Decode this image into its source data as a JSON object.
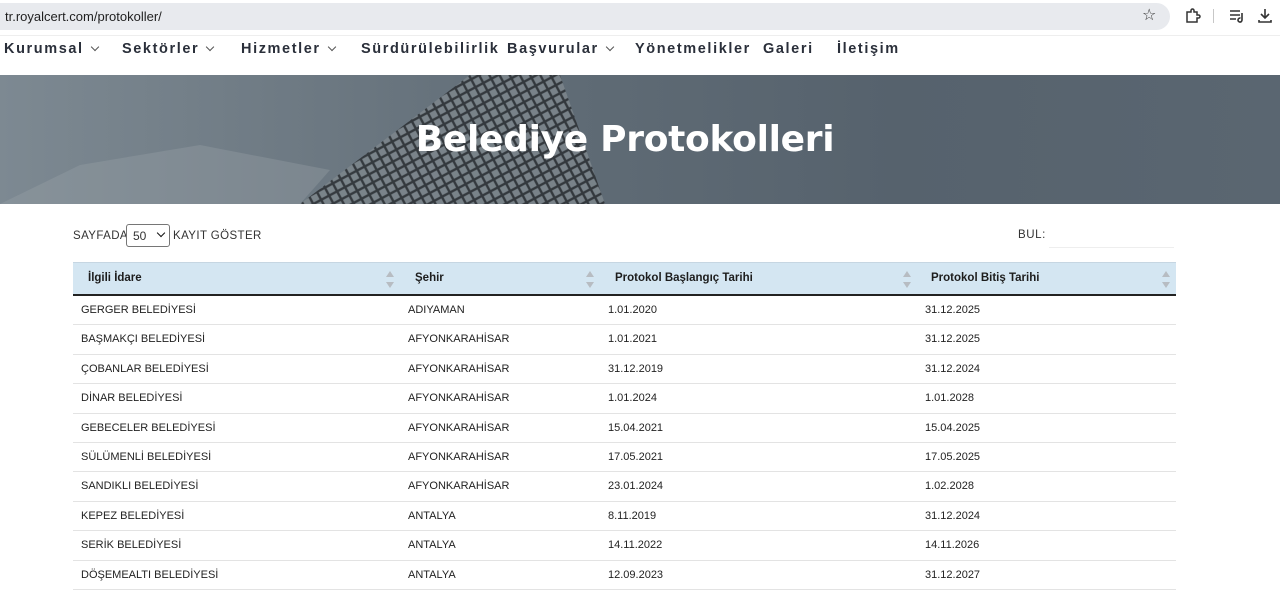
{
  "browser": {
    "url": "tr.royalcert.com/protokoller/"
  },
  "nav": {
    "items": [
      {
        "label": "Kurumsal",
        "has_menu": true
      },
      {
        "label": "Sektörler",
        "has_menu": true
      },
      {
        "label": "Hizmetler",
        "has_menu": true
      },
      {
        "label": "Sürdürülebilirlik",
        "has_menu": false
      },
      {
        "label": "Başvurular",
        "has_menu": true
      },
      {
        "label": "Yönetmelikler",
        "has_menu": false
      },
      {
        "label": "Galeri",
        "has_menu": false
      },
      {
        "label": "İletişim",
        "has_menu": false
      }
    ]
  },
  "hero": {
    "title": "Belediye Protokolleri"
  },
  "controls": {
    "length_prefix": "SAYFADA",
    "length_value": "50",
    "length_suffix": "KAYIT GÖSTER",
    "search_label": "BUL:"
  },
  "table": {
    "columns": [
      "İlgili İdare",
      "Şehir",
      "Protokol Başlangıç Tarihi",
      "Protokol Bitiş Tarihi"
    ],
    "rows": [
      [
        "GERGER BELEDİYESİ",
        "ADIYAMAN",
        "1.01.2020",
        "31.12.2025"
      ],
      [
        "BAŞMAKÇI BELEDİYESİ",
        "AFYONKARAHİSAR",
        "1.01.2021",
        "31.12.2025"
      ],
      [
        "ÇOBANLAR BELEDİYESİ",
        "AFYONKARAHİSAR",
        "31.12.2019",
        "31.12.2024"
      ],
      [
        "DİNAR BELEDİYESİ",
        "AFYONKARAHİSAR",
        "1.01.2024",
        "1.01.2028"
      ],
      [
        "GEBECELER BELEDİYESİ",
        "AFYONKARAHİSAR",
        "15.04.2021",
        "15.04.2025"
      ],
      [
        "SÜLÜMENLİ BELEDİYESİ",
        "AFYONKARAHİSAR",
        "17.05.2021",
        "17.05.2025"
      ],
      [
        "SANDIKLI BELEDİYESİ",
        "AFYONKARAHİSAR",
        "23.01.2024",
        "1.02.2028"
      ],
      [
        "KEPEZ BELEDİYESİ",
        "ANTALYA",
        "8.11.2019",
        "31.12.2024"
      ],
      [
        "SERİK BELEDİYESİ",
        "ANTALYA",
        "14.11.2022",
        "14.11.2026"
      ],
      [
        "DÖŞEMEALTI BELEDİYESİ",
        "ANTALYA",
        "12.09.2023",
        "31.12.2027"
      ]
    ]
  }
}
